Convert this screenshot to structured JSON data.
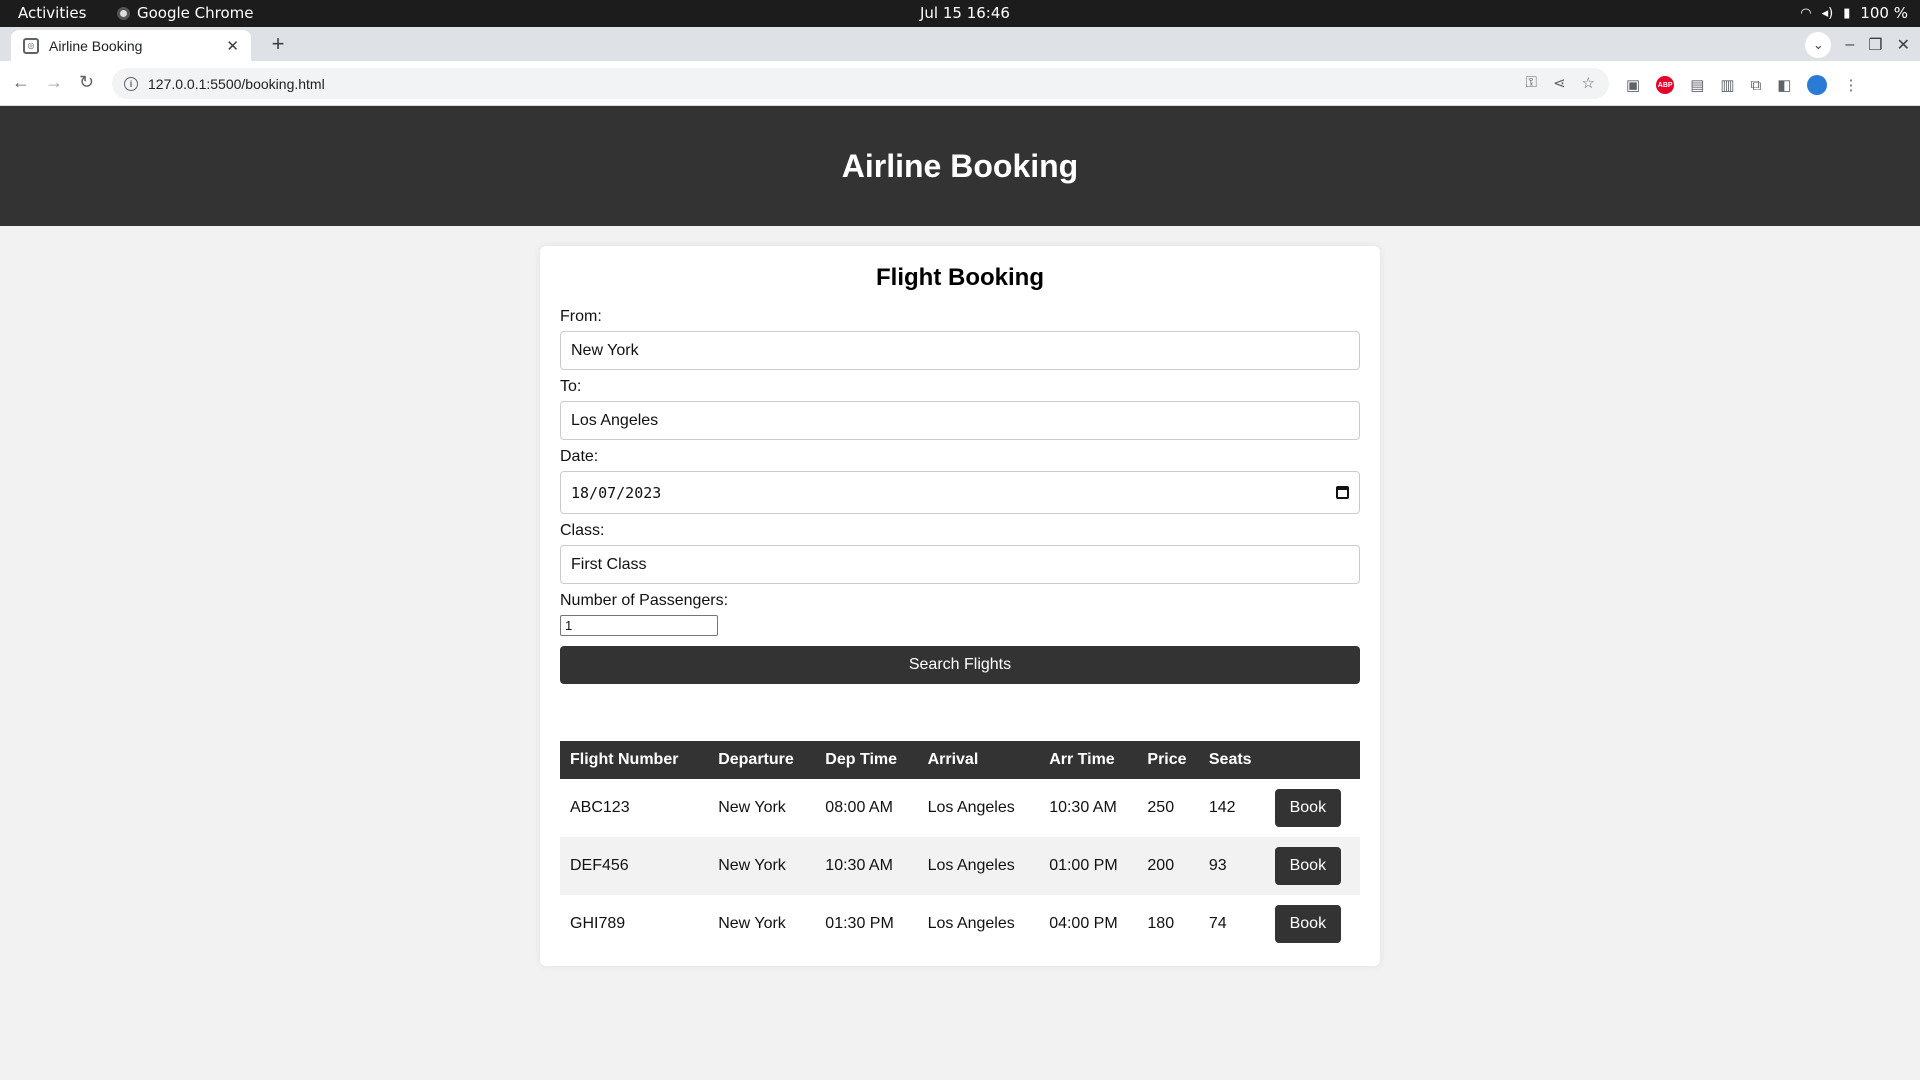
{
  "system_bar": {
    "activities": "Activities",
    "app_name": "Google Chrome",
    "clock": "Jul 15  16:46",
    "battery": "100 %"
  },
  "browser": {
    "tab_title": "Airline Booking",
    "url": "127.0.0.1:5500/booking.html"
  },
  "header": {
    "title": "Airline Booking"
  },
  "form": {
    "heading": "Flight Booking",
    "from_label": "From:",
    "from_value": "New York",
    "to_label": "To:",
    "to_value": "Los Angeles",
    "date_label": "Date:",
    "date_value": "18/07/2023",
    "class_label": "Class:",
    "class_value": "First Class",
    "passengers_label": "Number of Passengers:",
    "passengers_value": "1",
    "search_label": "Search Flights"
  },
  "results": {
    "columns": [
      "Flight Number",
      "Departure",
      "Dep Time",
      "Arrival",
      "Arr Time",
      "Price",
      "Seats",
      ""
    ],
    "rows": [
      {
        "flight": "ABC123",
        "departure": "New York",
        "dep_time": "08:00 AM",
        "arrival": "Los Angeles",
        "arr_time": "10:30 AM",
        "price": "250",
        "seats": "142",
        "action": "Book"
      },
      {
        "flight": "DEF456",
        "departure": "New York",
        "dep_time": "10:30 AM",
        "arrival": "Los Angeles",
        "arr_time": "01:00 PM",
        "price": "200",
        "seats": "93",
        "action": "Book"
      },
      {
        "flight": "GHI789",
        "departure": "New York",
        "dep_time": "01:30 PM",
        "arrival": "Los Angeles",
        "arr_time": "04:00 PM",
        "price": "180",
        "seats": "74",
        "action": "Book"
      }
    ]
  },
  "colors": {
    "header_bg": "#333333",
    "page_bg": "#f2f2f2",
    "card_bg": "#ffffff"
  }
}
